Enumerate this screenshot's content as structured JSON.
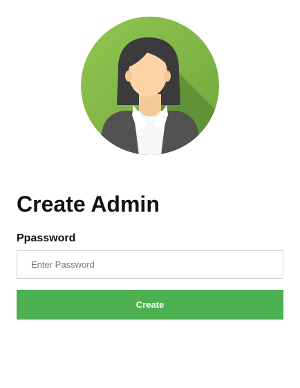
{
  "header": {
    "avatar_icon": "female-admin-avatar-icon",
    "avatar_bg_color": "#8bc34a"
  },
  "form": {
    "title": "Create Admin",
    "password_label": "Ppassword",
    "password_placeholder": "Enter Password",
    "password_value": "",
    "submit_label": "Create",
    "submit_color": "#4caf50"
  }
}
